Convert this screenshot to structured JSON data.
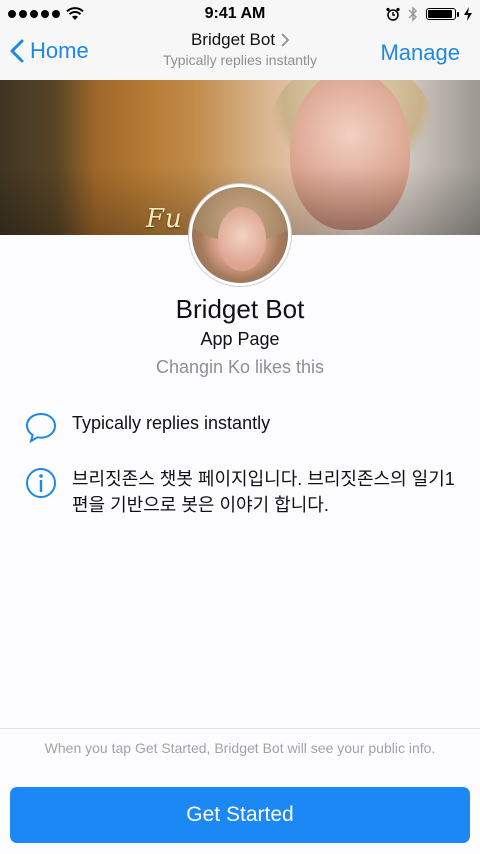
{
  "status": {
    "time": "9:41 AM"
  },
  "nav": {
    "back_label": "Home",
    "title": "Bridget Bot",
    "subtitle": "Typically replies instantly",
    "manage_label": "Manage"
  },
  "cover": {
    "caption": "Fu      ck!"
  },
  "profile": {
    "name": "Bridget Bot",
    "type": "App Page",
    "likes": "Changin Ko likes this"
  },
  "info": {
    "response": "Typically replies instantly",
    "about": "브리짓존스 챗봇 페이지입니다. 브리짓존스의 일기1편을 기반으로 봇은 이야기 합니다."
  },
  "footer": {
    "disclaimer": "When you tap Get Started, Bridget Bot will see your public info.",
    "cta_label": "Get Started"
  },
  "colors": {
    "accent": "#1e88e5",
    "button": "#1b88f5",
    "muted": "#8e8e93"
  },
  "icons": [
    "signal-icon",
    "wifi-icon",
    "alarm-icon",
    "bluetooth-icon",
    "battery-icon",
    "chevron-left-icon",
    "chevron-right-icon",
    "chat-bubble-icon",
    "info-icon"
  ]
}
